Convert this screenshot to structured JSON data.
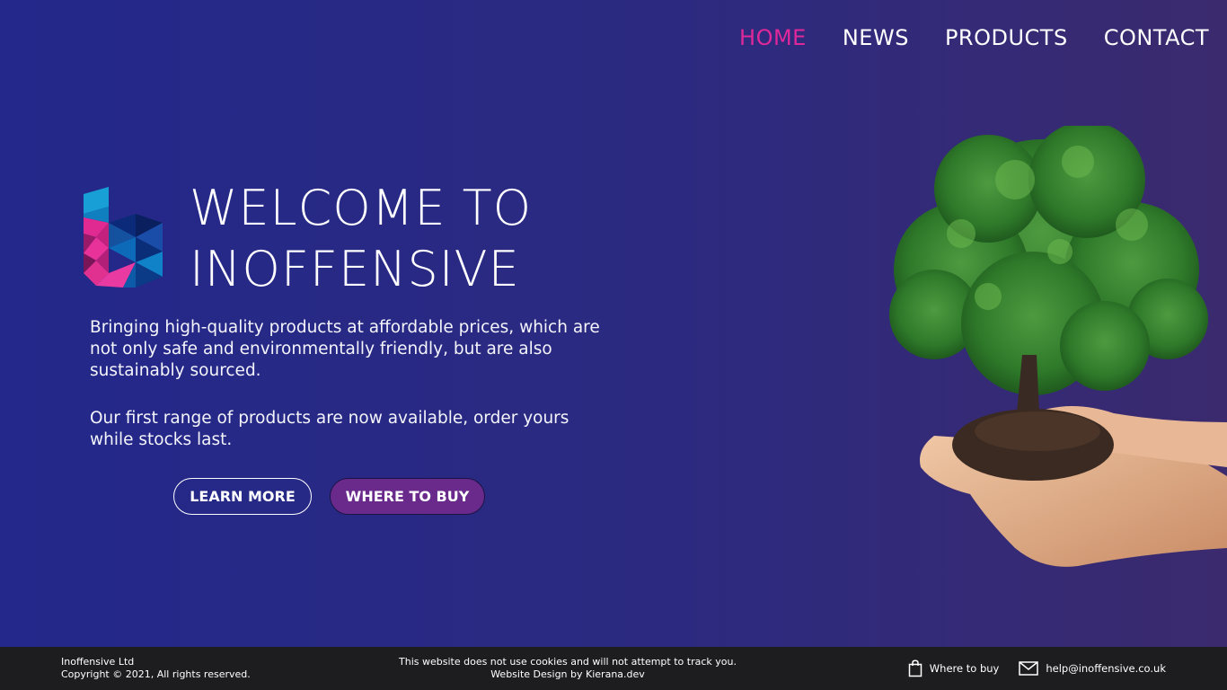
{
  "nav": {
    "items": [
      {
        "label": "HOME",
        "active": true
      },
      {
        "label": "NEWS",
        "active": false
      },
      {
        "label": "PRODUCTS",
        "active": false
      },
      {
        "label": "CONTACT",
        "active": false
      }
    ]
  },
  "hero": {
    "title_line1": "WELCOME TO",
    "title_line2": "INOFFENSIVE",
    "paragraph1": "Bringing high-quality products at affordable prices, which are not only safe and environmentally friendly, but are also sustainably sourced.",
    "paragraph2": "Our first range of products are now available, order yours while stocks last.",
    "learn_more_label": "LEARN MORE",
    "where_to_buy_label": "WHERE TO BUY"
  },
  "footer": {
    "company": "Inoffensive Ltd",
    "copyright": "Copyright © 2021, All rights reserved.",
    "cookie_notice": "This website does not use cookies and will not attempt to track you.",
    "design_credit": "Website Design by Kierana.dev",
    "where_to_buy_label": "Where to buy",
    "email": "help@inoffensive.co.uk"
  },
  "colors": {
    "accent": "#e0289a",
    "background_start": "#23288a",
    "background_end": "#3b2a6e",
    "footer_bg": "#1d1d1f",
    "buy_button": "#6a2a8c"
  },
  "icons": {
    "logo": "inoffensive-logo",
    "shopping_bag": "shopping-bag-icon",
    "envelope": "envelope-icon",
    "hero_image": "tree-in-hands-image"
  }
}
